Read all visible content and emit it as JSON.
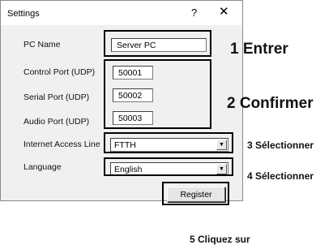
{
  "dialog": {
    "title": "Settings",
    "help": "?",
    "close": "✕"
  },
  "fields": {
    "pc_name": {
      "label": "PC Name",
      "value": "Server PC"
    },
    "control_port": {
      "label": "Control Port (UDP)",
      "value": "50001"
    },
    "serial_port": {
      "label": "Serial Port (UDP)",
      "value": "50002"
    },
    "audio_port": {
      "label": "Audio Port (UDP)",
      "value": "50003"
    },
    "internet_access_line": {
      "label": "Internet Access Line",
      "value": "FTTH"
    },
    "language": {
      "label": "Language",
      "value": "English"
    }
  },
  "register_button": "Register",
  "dropdown_arrow": "▼",
  "annotations": {
    "step1": "1 Entrer",
    "step2": "2 Confirmer",
    "step3": "3 Sélectionner",
    "step4": "4 Sélectionner",
    "step5": "5 Cliquez sur"
  },
  "icons": {
    "close": "close-icon",
    "help": "help-icon",
    "dropdown": "chevron-down-icon"
  }
}
